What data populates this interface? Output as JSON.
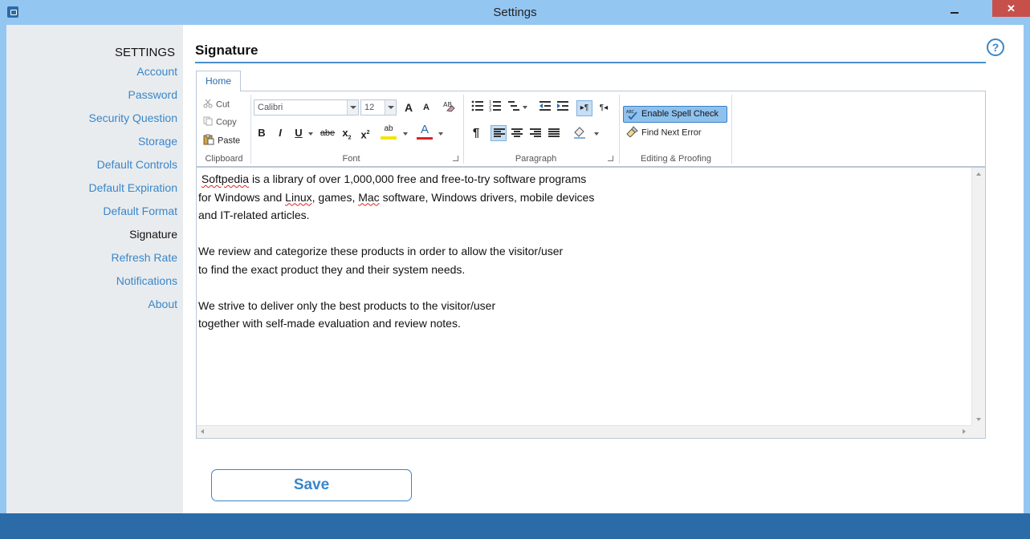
{
  "window": {
    "title": "Settings",
    "close_label": "✕"
  },
  "sidebar": {
    "heading": "SETTINGS",
    "items": [
      {
        "label": "Account",
        "active": false
      },
      {
        "label": "Password",
        "active": false
      },
      {
        "label": "Security Question",
        "active": false
      },
      {
        "label": "Storage",
        "active": false
      },
      {
        "label": "Default Controls",
        "active": false
      },
      {
        "label": "Default Expiration",
        "active": false
      },
      {
        "label": "Default Format",
        "active": false
      },
      {
        "label": "Signature",
        "active": true
      },
      {
        "label": "Refresh Rate",
        "active": false
      },
      {
        "label": "Notifications",
        "active": false
      },
      {
        "label": "About",
        "active": false
      }
    ]
  },
  "main": {
    "title": "Signature",
    "help_label": "?"
  },
  "ribbon": {
    "tab": "Home",
    "clipboard": {
      "cut": "Cut",
      "copy": "Copy",
      "paste": "Paste",
      "label": "Clipboard"
    },
    "font": {
      "family": "Calibri",
      "size": "12",
      "label": "Font",
      "grow": "A",
      "shrink": "A",
      "bold": "B",
      "italic": "I",
      "underline": "U",
      "strike": "abe",
      "subscript": "x",
      "superscript": "x",
      "highlight": "ab",
      "color": "A"
    },
    "paragraph": {
      "label": "Paragraph",
      "pilcrow": "¶"
    },
    "editing": {
      "spell_check": "Enable Spell Check",
      "find_next_error": "Find Next Error",
      "label": "Editing & Proofing"
    }
  },
  "editor": {
    "lines": [
      " Softpedia is a library of over 1,000,000 free and free-to-try software programs",
      "for Windows and Linux, games, Mac software, Windows drivers, mobile devices",
      "and IT-related articles.",
      "",
      "We review and categorize these products in order to allow the visitor/user",
      "to find the exact product they and their system needs.",
      "",
      "We strive to deliver only the best products to the visitor/user",
      "together with self-made evaluation and review notes."
    ]
  },
  "save_label": "Save",
  "colors": {
    "accent": "#3a86c8",
    "title_bar": "#94c6f2",
    "bottom_bar": "#2b6ba7",
    "sidebar_bg": "#e9ecef"
  }
}
